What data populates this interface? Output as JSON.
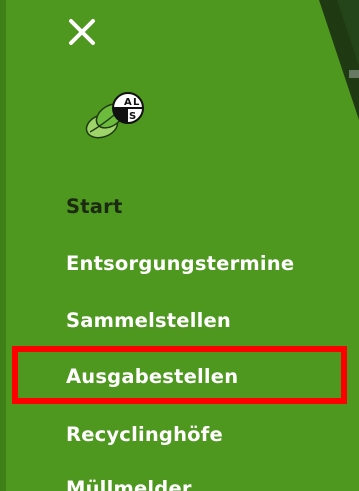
{
  "colors": {
    "drawer_background": "#4f981f",
    "active_item_text": "#1b2a10",
    "item_text": "#ffffff",
    "highlight_border": "#ff0000"
  },
  "header": {
    "close_icon": "close-icon",
    "logo_text": "ALS"
  },
  "menu": {
    "items": [
      {
        "label": "Start",
        "active": true
      },
      {
        "label": "Entsorgungstermine",
        "active": false
      },
      {
        "label": "Sammelstellen",
        "active": false
      },
      {
        "label": "Ausgabestellen",
        "active": false
      },
      {
        "label": "Recyclinghöfe",
        "active": false
      },
      {
        "label": "Müllmelder",
        "active": false
      }
    ]
  }
}
